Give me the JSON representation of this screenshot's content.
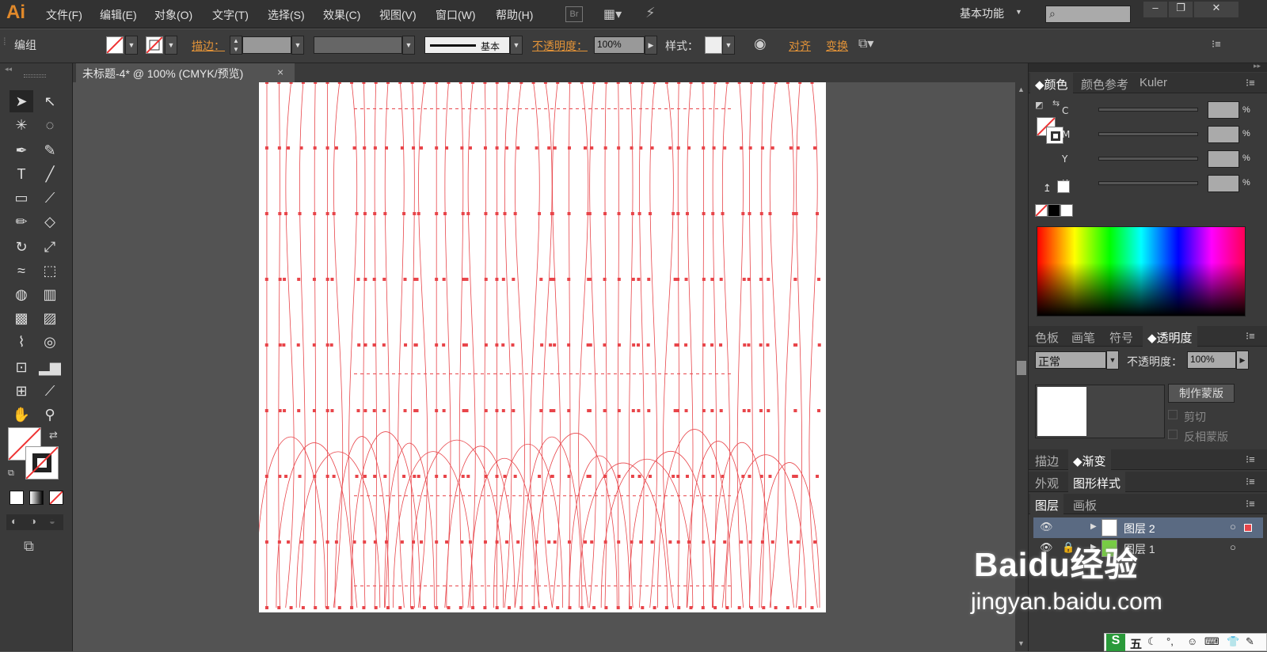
{
  "app": {
    "logo": "Ai",
    "workspace": "基本功能"
  },
  "menu": [
    "文件(F)",
    "编辑(E)",
    "对象(O)",
    "文字(T)",
    "选择(S)",
    "效果(C)",
    "视图(V)",
    "窗口(W)",
    "帮助(H)"
  ],
  "menu_extra": {
    "bridge": "Br"
  },
  "control": {
    "selection": "编组",
    "stroke_label": "描边：",
    "stroke_profile": "基本",
    "opacity_label": "不透明度：",
    "opacity_value": "100%",
    "style_label": "样式：",
    "align_label": "对齐",
    "transform_label": "变换"
  },
  "document": {
    "tab_title": "未标题-4* @ 100% (CMYK/预览)",
    "close": "×"
  },
  "color_panel": {
    "tabs": [
      "颜色",
      "颜色参考",
      "Kuler"
    ],
    "channels": [
      "C",
      "M",
      "Y",
      "K"
    ],
    "pct": "%"
  },
  "transparency_panel": {
    "tabs": [
      "色板",
      "画笔",
      "符号",
      "透明度"
    ],
    "blend_mode": "正常",
    "opacity_label": "不透明度：",
    "opacity_value": "100%",
    "make_mask": "制作蒙版",
    "clip": "剪切",
    "invert_mask": "反相蒙版"
  },
  "stroke_gradient_tabs": [
    "描边",
    "渐变"
  ],
  "appearance_tabs": [
    "外观",
    "图形样式"
  ],
  "layers_panel": {
    "tabs": [
      "图层",
      "画板"
    ],
    "layers": [
      {
        "name": "图层 2"
      },
      {
        "name": "图层 1"
      }
    ]
  },
  "watermark": {
    "logo": "Baidu经验",
    "url": "jingyan.baidu.com"
  },
  "ime": {
    "label": "五"
  },
  "colors": {
    "accent": "#e39338",
    "path": "#e8454a",
    "layer_color": "#e8454a"
  }
}
